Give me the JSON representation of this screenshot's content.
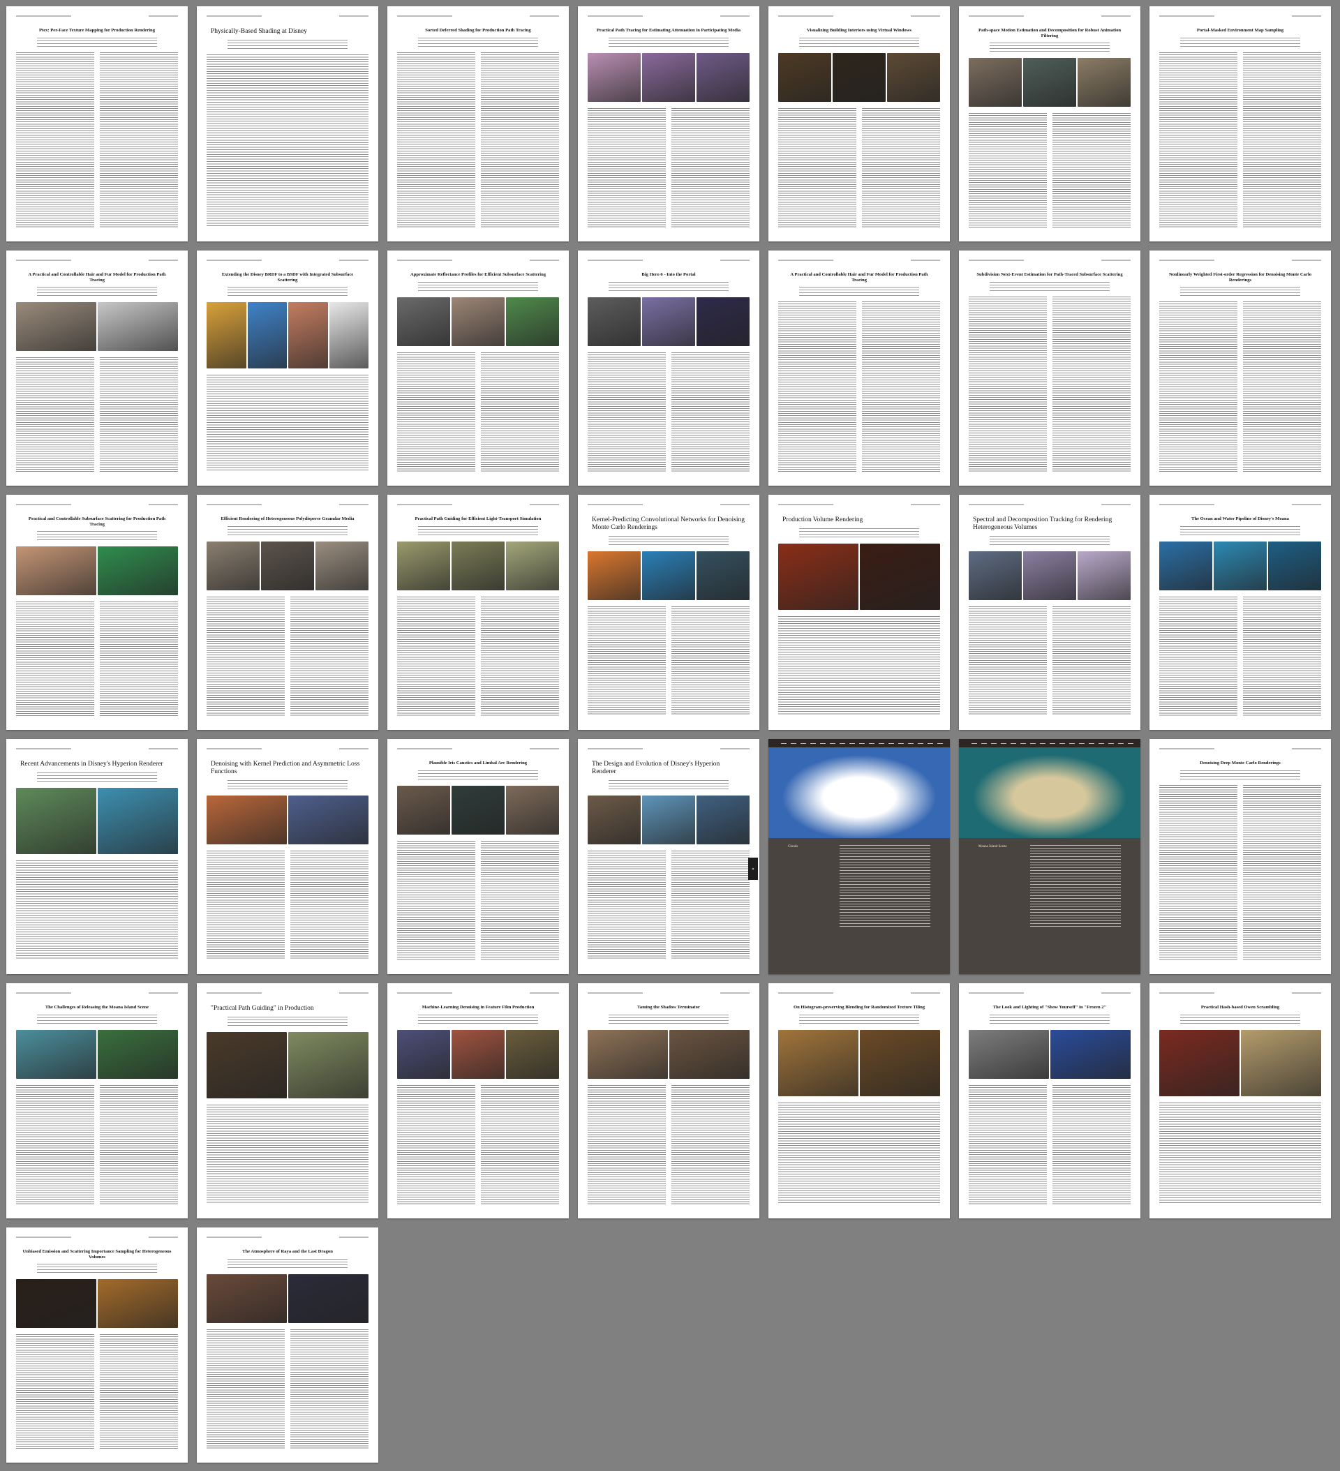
{
  "document": {
    "pages": [
      {
        "title": "Ptex: Per-Face Texture Mapping for Production Rendering",
        "layout": "two-col"
      },
      {
        "title": "Physically-Based Shading at Disney",
        "layout": "single",
        "title_style": "left"
      },
      {
        "title": "Sorted Deferred Shading for Production Path Tracing",
        "layout": "two-col"
      },
      {
        "title": "Practical Path Tracing for Estimating Attenuation in Participating Media",
        "layout": "fig-two-col",
        "fig_colors": [
          "#b98fb3",
          "#8a6a9b",
          "#6f5a86"
        ]
      },
      {
        "title": "Visualizing Building Interiors using Virtual Windows",
        "layout": "fig-two-col",
        "fig_colors": [
          "#4e3a24",
          "#2f261c",
          "#5d4a35"
        ]
      },
      {
        "title": "Path-space Motion Estimation and Decomposition for Robust Animation Filtering",
        "layout": "fig-two-col",
        "fig_colors": [
          "#7c6d5f",
          "#4f5e58",
          "#8b7c65"
        ]
      },
      {
        "title": "Portal-Masked Environment Map Sampling",
        "layout": "two-col"
      },
      {
        "title": "A Practical and Controllable Hair and Fur Model for Production Path Tracing",
        "layout": "fig-two-col",
        "fig_colors": [
          "#9a8b7c",
          "#c7c7c7"
        ]
      },
      {
        "title": "Extending the Disney BRDF to a BSDF with Integrated Subsurface Scattering",
        "layout": "fig-single",
        "fig_colors": [
          "#d9a13a",
          "#3f83c9",
          "#c47d61",
          "#e8e8e8"
        ]
      },
      {
        "title": "Approximate Reflectance Profiles for Efficient Subsurface Scattering",
        "layout": "fig-two-col",
        "fig_colors": [
          "#6a6a6a",
          "#9c8677",
          "#4f8a4b"
        ]
      },
      {
        "title": "Big Hero 6 - Into the Portal",
        "layout": "fig-two-col",
        "fig_colors": [
          "#5d5d5d",
          "#7a6fa3",
          "#2e2a4a"
        ]
      },
      {
        "title": "A Practical and Controllable Hair and Fur Model for Production Path Tracing",
        "layout": "two-col"
      },
      {
        "title": "Subdivision Next-Event Estimation for Path-Traced Subsurface Scattering",
        "layout": "two-col"
      },
      {
        "title": "Nonlinearly Weighted First-order Regression for Denoising Monte Carlo Renderings",
        "layout": "two-col"
      },
      {
        "title": "Practical and Controllable Subsurface Scattering for Production Path Tracing",
        "layout": "fig-two-col",
        "fig_colors": [
          "#c49575",
          "#2f8d4e"
        ]
      },
      {
        "title": "Efficient Rendering of Heterogeneous Polydisperse Granular Media",
        "layout": "fig-two-col",
        "fig_colors": [
          "#8b7f70",
          "#5c544c",
          "#9a8e80"
        ]
      },
      {
        "title": "Practical Path Guiding for Efficient Light-Transport Simulation",
        "layout": "fig-two-col",
        "fig_colors": [
          "#9a9b6c",
          "#7a7c56",
          "#a3a77a"
        ]
      },
      {
        "title": "Kernel-Predicting Convolutional Networks for Denoising Monte Carlo Renderings",
        "layout": "fig-two-col",
        "title_style": "left",
        "fig_colors": [
          "#d9772f",
          "#2a7fb7",
          "#34505f"
        ]
      },
      {
        "title": "Production Volume Rendering",
        "layout": "fig-single",
        "title_style": "left",
        "fig_colors": [
          "#8a2e17",
          "#3a1d14"
        ]
      },
      {
        "title": "Spectral and Decomposition Tracking for Rendering Heterogeneous Volumes",
        "layout": "fig-two-col",
        "title_style": "left",
        "fig_colors": [
          "#5e6c82",
          "#8b7fa1",
          "#b9a9c9"
        ]
      },
      {
        "title": "The Ocean and Water Pipeline of Disney's Moana",
        "layout": "fig-two-col",
        "fig_colors": [
          "#2b6fa6",
          "#2c89b3",
          "#1d5f85"
        ]
      },
      {
        "title": "Recent Advancements in Disney's Hyperion Renderer",
        "layout": "fig-single",
        "title_style": "left",
        "fig_colors": [
          "#5e8a5a",
          "#3d8fb0"
        ]
      },
      {
        "title": "Denoising with Kernel Prediction and Asymmetric Loss Functions",
        "layout": "fig-two-col",
        "title_style": "left",
        "fig_colors": [
          "#b9673a",
          "#4e5f8c"
        ]
      },
      {
        "title": "Plausible Iris Caustics and Limbal Arc Rendering",
        "layout": "fig-two-col",
        "fig_colors": [
          "#6b5a4c",
          "#2f3d3a",
          "#7d6a5a"
        ]
      },
      {
        "title": "The Design and Evolution of Disney's Hyperion Renderer",
        "layout": "fig-two-col",
        "title_style": "left",
        "fig_colors": [
          "#6c5a48",
          "#5e94b9",
          "#3f607f"
        ]
      },
      {
        "title": "Clouds",
        "layout": "web",
        "fig_colors": [
          "#3768b3",
          "#ffffff"
        ]
      },
      {
        "title": "Moana Island Scene",
        "layout": "web",
        "fig_colors": [
          "#1e6b73",
          "#d6c89c"
        ]
      },
      {
        "title": "Denoising Deep Monte Carlo Renderings",
        "layout": "two-col"
      },
      {
        "title": "The Challenges of Releasing the Moana Island Scene",
        "layout": "fig-two-col",
        "fig_colors": [
          "#4b8f9c",
          "#396f3d"
        ]
      },
      {
        "title": "\"Practical Path Guiding\" in Production",
        "layout": "fig-single",
        "title_style": "left",
        "fig_colors": [
          "#4a3a2a",
          "#7f8a5f"
        ]
      },
      {
        "title": "Machine-Learning Denoising in Feature Film Production",
        "layout": "fig-two-col",
        "fig_colors": [
          "#4d4f78",
          "#a0533f",
          "#6a5d3c"
        ]
      },
      {
        "title": "Taming the Shadow Terminator",
        "layout": "fig-two-col",
        "fig_colors": [
          "#8e7257",
          "#6a5440"
        ]
      },
      {
        "title": "On Histogram-preserving Blending for Randomized Texture Tiling",
        "layout": "fig-single",
        "fig_colors": [
          "#a0743a",
          "#6b4a26"
        ]
      },
      {
        "title": "The Look and Lighting of \"Show Yourself\" in \"Frozen 2\"",
        "layout": "fig-two-col",
        "fig_colors": [
          "#7d7d7d",
          "#2a4c9a"
        ]
      },
      {
        "title": "Practical Hash-based Owen Scrambling",
        "layout": "fig-single",
        "fig_colors": [
          "#7a2a20",
          "#b49c6c"
        ]
      },
      {
        "title": "Unbiased Emission and Scattering Importance Sampling for Heterogeneous Volumes",
        "layout": "fig-two-col",
        "fig_colors": [
          "#2a1f18",
          "#a36b2a"
        ]
      },
      {
        "title": "The Atmosphere of Raya and the Last Dragon",
        "layout": "fig-two-col",
        "fig_colors": [
          "#6a4a3a",
          "#2b2b3a"
        ]
      }
    ],
    "side_tab": "»"
  }
}
